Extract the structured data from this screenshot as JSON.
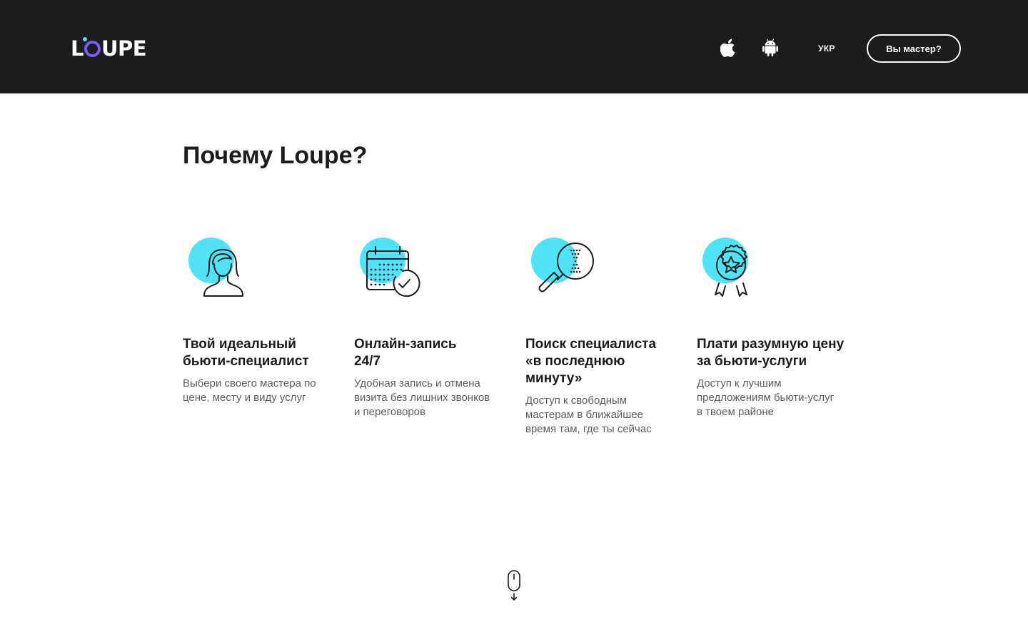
{
  "header": {
    "logo": "LOUPE",
    "lang_label": "УКР",
    "master_button": "Вы мастер?",
    "store_icons": [
      "apple-icon",
      "android-icon"
    ]
  },
  "main": {
    "title": "Почему Loupe?",
    "features": [
      {
        "icon": "woman-icon",
        "title": "Твой идеальный\nбьюти-специалист",
        "desc": "Выбери своего мастера по\nцене, месту и виду услуг"
      },
      {
        "icon": "calendar-check-icon",
        "title": "Онлайн-запись\n24/7",
        "desc": "Удобная запись и отмена\nвизита без лишних звонков\nи переговоров"
      },
      {
        "icon": "magnifier-hourglass-icon",
        "title": "Поиск специалиста\n«в последнюю\nминуту»",
        "desc": "Доступ к свободным\nмастерам в ближайшее\nвремя там, где ты сейчас"
      },
      {
        "icon": "award-star-icon",
        "title": "Плати разумную цену\nза бьюти-услуги",
        "desc": "Доступ к лучшим\nпредложениям бьюти-услуг\nв твоем районе"
      }
    ]
  },
  "colors": {
    "header_bg": "#1c1c1f",
    "accent_cyan": "#50e3f7",
    "logo_purple": "#7b5cf0",
    "text_dark": "#1c1c1f",
    "text_muted": "#5d5d62"
  }
}
